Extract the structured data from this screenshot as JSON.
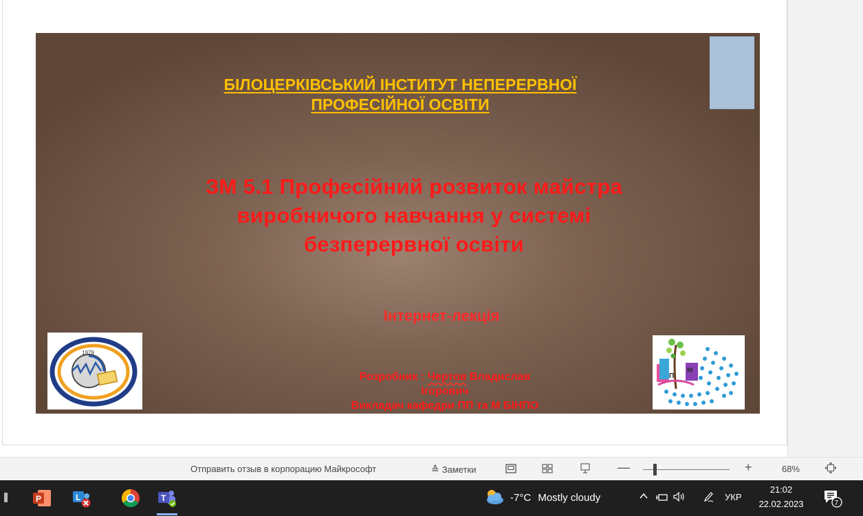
{
  "slide": {
    "institute_line1": "БІЛОЦЕРКІВСЬКИЙ ІНСТИТУТ НЕПЕРЕРВНОЇ",
    "institute_line2": "ПРОФЕСІЙНОЇ ОСВІТИ",
    "module_line1": "ЗМ 5.1 Професійний розвиток майстра",
    "module_line2": "виробничого навчання у системі",
    "module_line3": "безперервної освіти",
    "lecture_type": "Інтернет-лекція",
    "author_prefix": "Розробник : ",
    "author_surname": "Чертов",
    "author_name": " Владислав",
    "author_patronymic": "Ігорович",
    "author_position": "Викладач кафедри ПП та М БІНПО",
    "right_logo_letters": [
      "П",
      "М"
    ],
    "left_logo_year": "1979"
  },
  "statusbar": {
    "feedback": "Отправить отзыв в корпорацию Майкрософт",
    "notes": "Заметки",
    "zoom_minus": "—",
    "zoom_plus": "+",
    "zoom_percent": "68%",
    "zoom_level": 0.14
  },
  "taskbar": {
    "apps": [
      "powerpoint-icon",
      "lync-icon",
      "chrome-icon",
      "teams-icon"
    ],
    "weather_temp": "-7°C",
    "weather_desc": "Mostly cloudy",
    "language": "УКР",
    "time": "21:02",
    "date": "22.02.2023",
    "notification_count": "7"
  },
  "colors": {
    "title_gold": "#ffc000",
    "title_red": "#ff1a1a",
    "slide_bg_dark": "#5f4738",
    "slide_bg_light": "#9c8170",
    "bookmark_blue": "#a9c1d9",
    "taskbar_bg": "#1f1f1f"
  }
}
